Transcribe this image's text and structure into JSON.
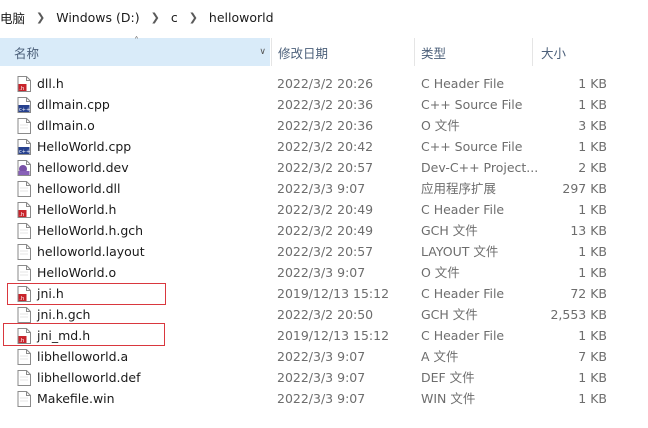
{
  "breadcrumb": [
    "电脑",
    "Windows (D:)",
    "c",
    "helloworld"
  ],
  "columns": {
    "name": "名称",
    "date": "修改日期",
    "type": "类型",
    "size": "大小"
  },
  "files": [
    {
      "name": "dll.h",
      "date": "2022/3/2 20:26",
      "type": "C Header File",
      "size": "1 KB",
      "icon": "c-header-icon"
    },
    {
      "name": "dllmain.cpp",
      "date": "2022/3/2 20:36",
      "type": "C++ Source File",
      "size": "1 KB",
      "icon": "cpp-source-icon"
    },
    {
      "name": "dllmain.o",
      "date": "2022/3/2 20:36",
      "type": "O 文件",
      "size": "3 KB",
      "icon": "blank-file-icon"
    },
    {
      "name": "HelloWorld.cpp",
      "date": "2022/3/2 20:42",
      "type": "C++ Source File",
      "size": "1 KB",
      "icon": "cpp-source-icon"
    },
    {
      "name": "helloworld.dev",
      "date": "2022/3/2 20:57",
      "type": "Dev-C++ Project...",
      "size": "2 KB",
      "icon": "dev-project-icon"
    },
    {
      "name": "helloworld.dll",
      "date": "2022/3/3 9:07",
      "type": "应用程序扩展",
      "size": "297 KB",
      "icon": "blank-file-icon"
    },
    {
      "name": "HelloWorld.h",
      "date": "2022/3/2 20:49",
      "type": "C Header File",
      "size": "1 KB",
      "icon": "c-header-icon"
    },
    {
      "name": "HelloWorld.h.gch",
      "date": "2022/3/2 20:49",
      "type": "GCH 文件",
      "size": "13 KB",
      "icon": "blank-file-icon"
    },
    {
      "name": "helloworld.layout",
      "date": "2022/3/2 20:57",
      "type": "LAYOUT 文件",
      "size": "1 KB",
      "icon": "blank-file-icon"
    },
    {
      "name": "HelloWorld.o",
      "date": "2022/3/3 9:07",
      "type": "O 文件",
      "size": "1 KB",
      "icon": "blank-file-icon"
    },
    {
      "name": "jni.h",
      "date": "2019/12/13 15:12",
      "type": "C Header File",
      "size": "72 KB",
      "icon": "c-header-icon"
    },
    {
      "name": "jni.h.gch",
      "date": "2022/3/2 20:50",
      "type": "GCH 文件",
      "size": "2,553 KB",
      "icon": "blank-file-icon"
    },
    {
      "name": "jni_md.h",
      "date": "2019/12/13 15:12",
      "type": "C Header File",
      "size": "1 KB",
      "icon": "c-header-icon"
    },
    {
      "name": "libhelloworld.a",
      "date": "2022/3/3 9:07",
      "type": "A 文件",
      "size": "7 KB",
      "icon": "blank-file-icon"
    },
    {
      "name": "libhelloworld.def",
      "date": "2022/3/3 9:07",
      "type": "DEF 文件",
      "size": "1 KB",
      "icon": "blank-file-icon"
    },
    {
      "name": "Makefile.win",
      "date": "2022/3/3 9:07",
      "type": "WIN 文件",
      "size": "1 KB",
      "icon": "blank-file-icon"
    }
  ],
  "colors": {
    "highlight_box": "#d9373e",
    "header_selected": "#d9ebf9",
    "header_text": "#4c607a",
    "meta_text": "#6d6d6d"
  }
}
